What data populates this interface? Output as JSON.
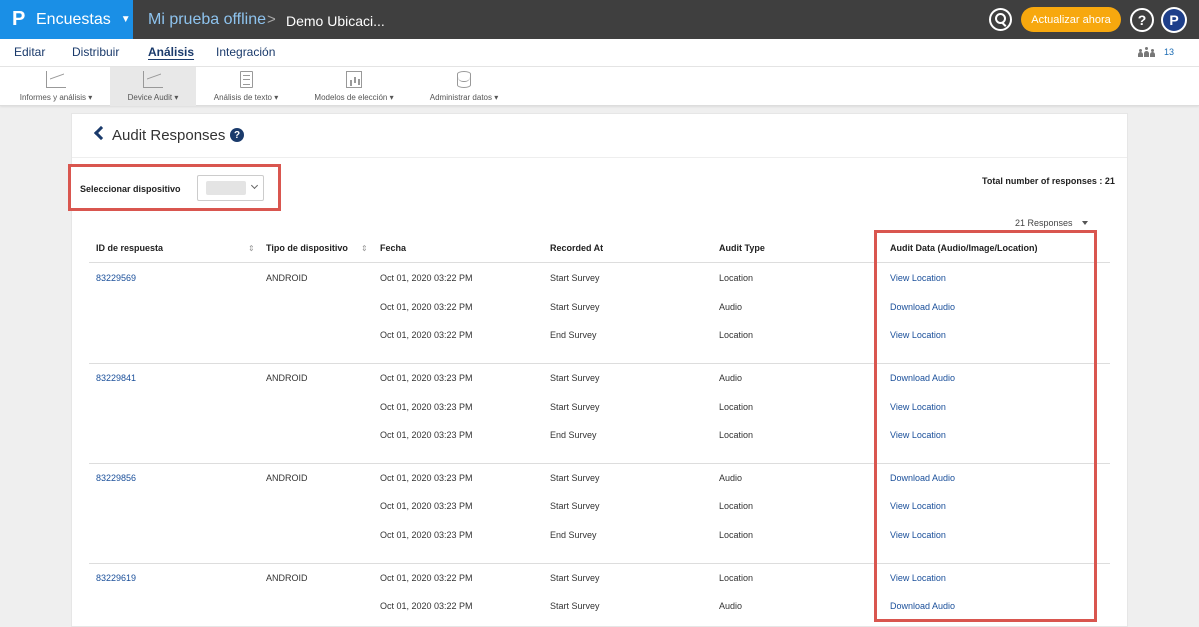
{
  "topbar": {
    "brand_logo": "P",
    "brand_name": "Encuestas",
    "crumb1": "Mi prueba offline",
    "crumb_sep": ">",
    "crumb2": "Demo Ubicaci...",
    "upgrade_label": "Actualizar ahora",
    "help_label": "?",
    "profile_label": "P"
  },
  "mainnav": {
    "items": [
      "Editar",
      "Distribuir",
      "Análisis",
      "Integración"
    ],
    "active": "Análisis",
    "people_count": "13"
  },
  "toolbar": {
    "items": [
      "Informes y análisis",
      "Device Audit",
      "Análisis de texto",
      "Modelos de elección",
      "Administrar datos"
    ],
    "active": "Device Audit"
  },
  "panel": {
    "title": "Audit Responses",
    "help": "?",
    "device_label": "Seleccionar dispositivo",
    "total": "Total number of responses : 21",
    "page_size": "21 Responses"
  },
  "table": {
    "columns": [
      "ID de respuesta",
      "Tipo de dispositivo",
      "Fecha",
      "Recorded At",
      "Audit Type",
      "Audit Data (Audio/Image/Location)"
    ],
    "groups": [
      {
        "id": "83229569",
        "device": "ANDROID",
        "rows": [
          {
            "fecha": "Oct 01, 2020 03:22 PM",
            "recorded": "Start Survey",
            "type": "Location",
            "data": "View Location"
          },
          {
            "fecha": "Oct 01, 2020 03:22 PM",
            "recorded": "Start Survey",
            "type": "Audio",
            "data": "Download Audio"
          },
          {
            "fecha": "Oct 01, 2020 03:22 PM",
            "recorded": "End Survey",
            "type": "Location",
            "data": "View Location"
          }
        ]
      },
      {
        "id": "83229841",
        "device": "ANDROID",
        "rows": [
          {
            "fecha": "Oct 01, 2020 03:23 PM",
            "recorded": "Start Survey",
            "type": "Audio",
            "data": "Download Audio"
          },
          {
            "fecha": "Oct 01, 2020 03:23 PM",
            "recorded": "Start Survey",
            "type": "Location",
            "data": "View Location"
          },
          {
            "fecha": "Oct 01, 2020 03:23 PM",
            "recorded": "End Survey",
            "type": "Location",
            "data": "View Location"
          }
        ]
      },
      {
        "id": "83229856",
        "device": "ANDROID",
        "rows": [
          {
            "fecha": "Oct 01, 2020 03:23 PM",
            "recorded": "Start Survey",
            "type": "Audio",
            "data": "Download Audio"
          },
          {
            "fecha": "Oct 01, 2020 03:23 PM",
            "recorded": "Start Survey",
            "type": "Location",
            "data": "View Location"
          },
          {
            "fecha": "Oct 01, 2020 03:23 PM",
            "recorded": "End Survey",
            "type": "Location",
            "data": "View Location"
          }
        ]
      },
      {
        "id": "83229619",
        "device": "ANDROID",
        "rows": [
          {
            "fecha": "Oct 01, 2020 03:22 PM",
            "recorded": "Start Survey",
            "type": "Location",
            "data": "View Location"
          },
          {
            "fecha": "Oct 01, 2020 03:22 PM",
            "recorded": "Start Survey",
            "type": "Audio",
            "data": "Download Audio"
          }
        ]
      }
    ]
  },
  "colors": {
    "brand": "#1a8fe6",
    "topbar": "#3f3f3f",
    "upgrade": "#f7a80e",
    "highlight": "#d9564f",
    "link": "#1a4f9a"
  }
}
